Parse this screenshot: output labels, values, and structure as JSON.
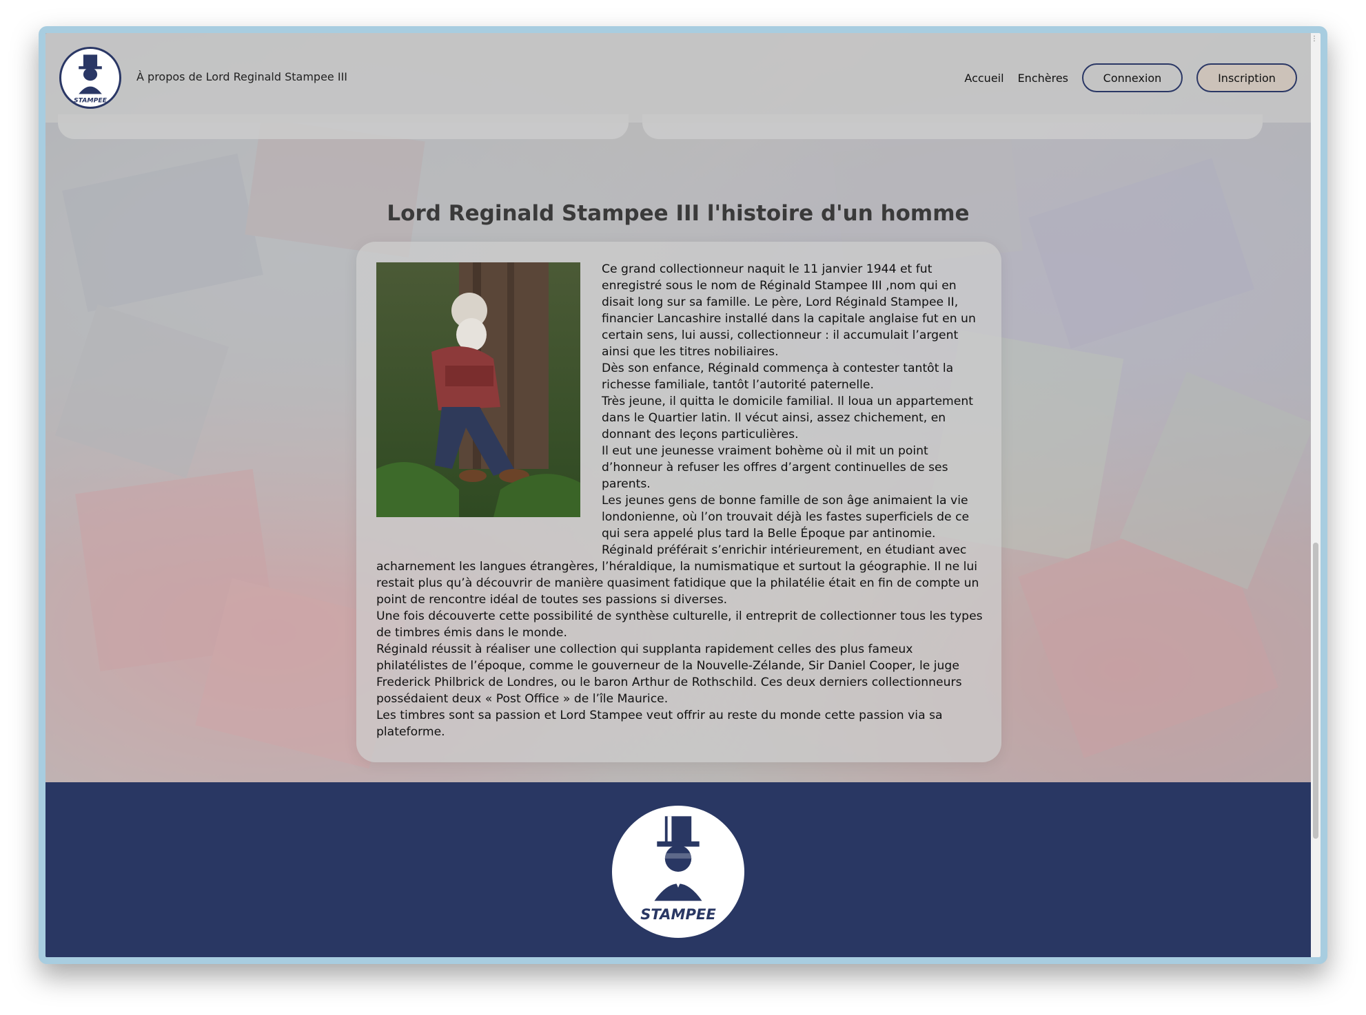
{
  "header": {
    "logo_text": "STAMPEE",
    "title": "À propos de Lord Reginald Stampee III",
    "nav": {
      "home": "Accueil",
      "auctions": "Enchères",
      "login": "Connexion",
      "signup": "Inscription"
    }
  },
  "main": {
    "title": "Lord Reginald Stampee III l'histoire d'un homme",
    "paragraphs": [
      "Ce grand collectionneur naquit le 11 janvier 1944 et fut enregistré sous le nom de Réginald Stampee III ,nom qui en disait long sur sa famille. Le père, Lord Réginald Stampee II, financier Lancashire installé dans la capitale anglaise fut en un certain sens, lui aussi, collectionneur : il accumulait l’argent ainsi que les titres nobiliaires.",
      "Dès son enfance, Réginald commença à contester tantôt la richesse familiale, tantôt l’autorité paternelle.",
      "Très jeune, il quitta le domicile familial. Il loua un appartement dans le Quartier latin. Il vécut ainsi, assez chichement, en donnant des leçons particulières.",
      "Il eut une jeunesse vraiment bohème où il mit un point d’honneur à refuser les offres d’argent continuelles de ses parents.",
      "Les jeunes gens de bonne famille de son âge animaient la vie londonienne, où l’on trouvait déjà les fastes superficiels de ce qui sera appelé plus tard la Belle Époque par antinomie.",
      "Réginald préférait s’enrichir intérieurement, en étudiant avec acharnement les langues étrangères, l’héraldique, la numismatique et surtout la géographie. Il ne lui restait plus qu’à découvrir de manière quasiment fatidique que la philatélie était en fin de compte un point de rencontre idéal de toutes ses passions si diverses.",
      "Une fois découverte cette possibilité de synthèse culturelle, il entreprit de collectionner tous les types de timbres émis dans le monde.",
      "Réginald réussit à réaliser une collection qui supplanta rapidement celles des plus fameux philatélistes de l’époque, comme le gouverneur de la Nouvelle-Zélande, Sir Daniel Cooper, le juge Frederick Philbrick de Londres, ou le baron Arthur de Rothschild. Ces deux derniers collectionneurs possédaient deux « Post Office » de l’île Maurice.",
      "Les timbres sont sa passion et Lord Stampee veut offrir au reste du monde cette passion via sa plateforme."
    ]
  },
  "footer": {
    "logo_text": "STAMPEE"
  },
  "colors": {
    "brand_navy": "#293763",
    "frame": "#a8cde0"
  },
  "icons": [
    "stampee-logo-icon",
    "portrait-image",
    "kebab-menu-icon"
  ]
}
